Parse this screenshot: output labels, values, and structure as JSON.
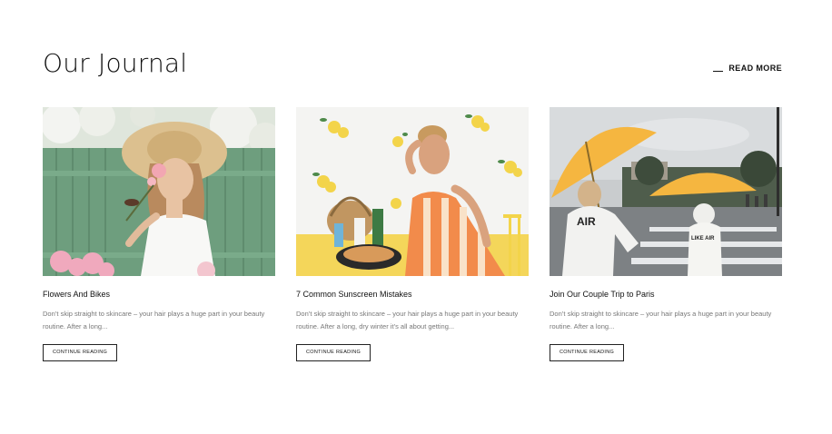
{
  "journal": {
    "title": "Our Journal",
    "read_more_label": "READ MORE"
  },
  "posts": [
    {
      "title": "Flowers And Bikes",
      "excerpt": "Don’t skip straight to skincare – your hair plays a huge part in your beauty routine. After a long...",
      "button_label": "CONTINUE READING",
      "image_subject": "woman-with-straw-hat-and-flowers"
    },
    {
      "title": "7 Common Sunscreen Mistakes",
      "excerpt": "Don’t skip straight to skincare – your hair plays a huge part in your beauty routine. After a long, dry winter it’s all about getting...",
      "button_label": "CONTINUE READING",
      "image_subject": "woman-with-lemons-and-picnic"
    },
    {
      "title": "Join Our Couple Trip to Paris",
      "excerpt": "Don’t skip straight to skincare – your hair plays a huge part in your beauty routine. After a long...",
      "button_label": "CONTINUE READING",
      "image_subject": "couple-with-yellow-umbrellas"
    }
  ],
  "colors": {
    "text": "#111111",
    "muted_text": "#777777",
    "umbrella_yellow": "#F5B640",
    "fence_green": "#6E9E7E",
    "lemon_yellow": "#F3D44A"
  }
}
